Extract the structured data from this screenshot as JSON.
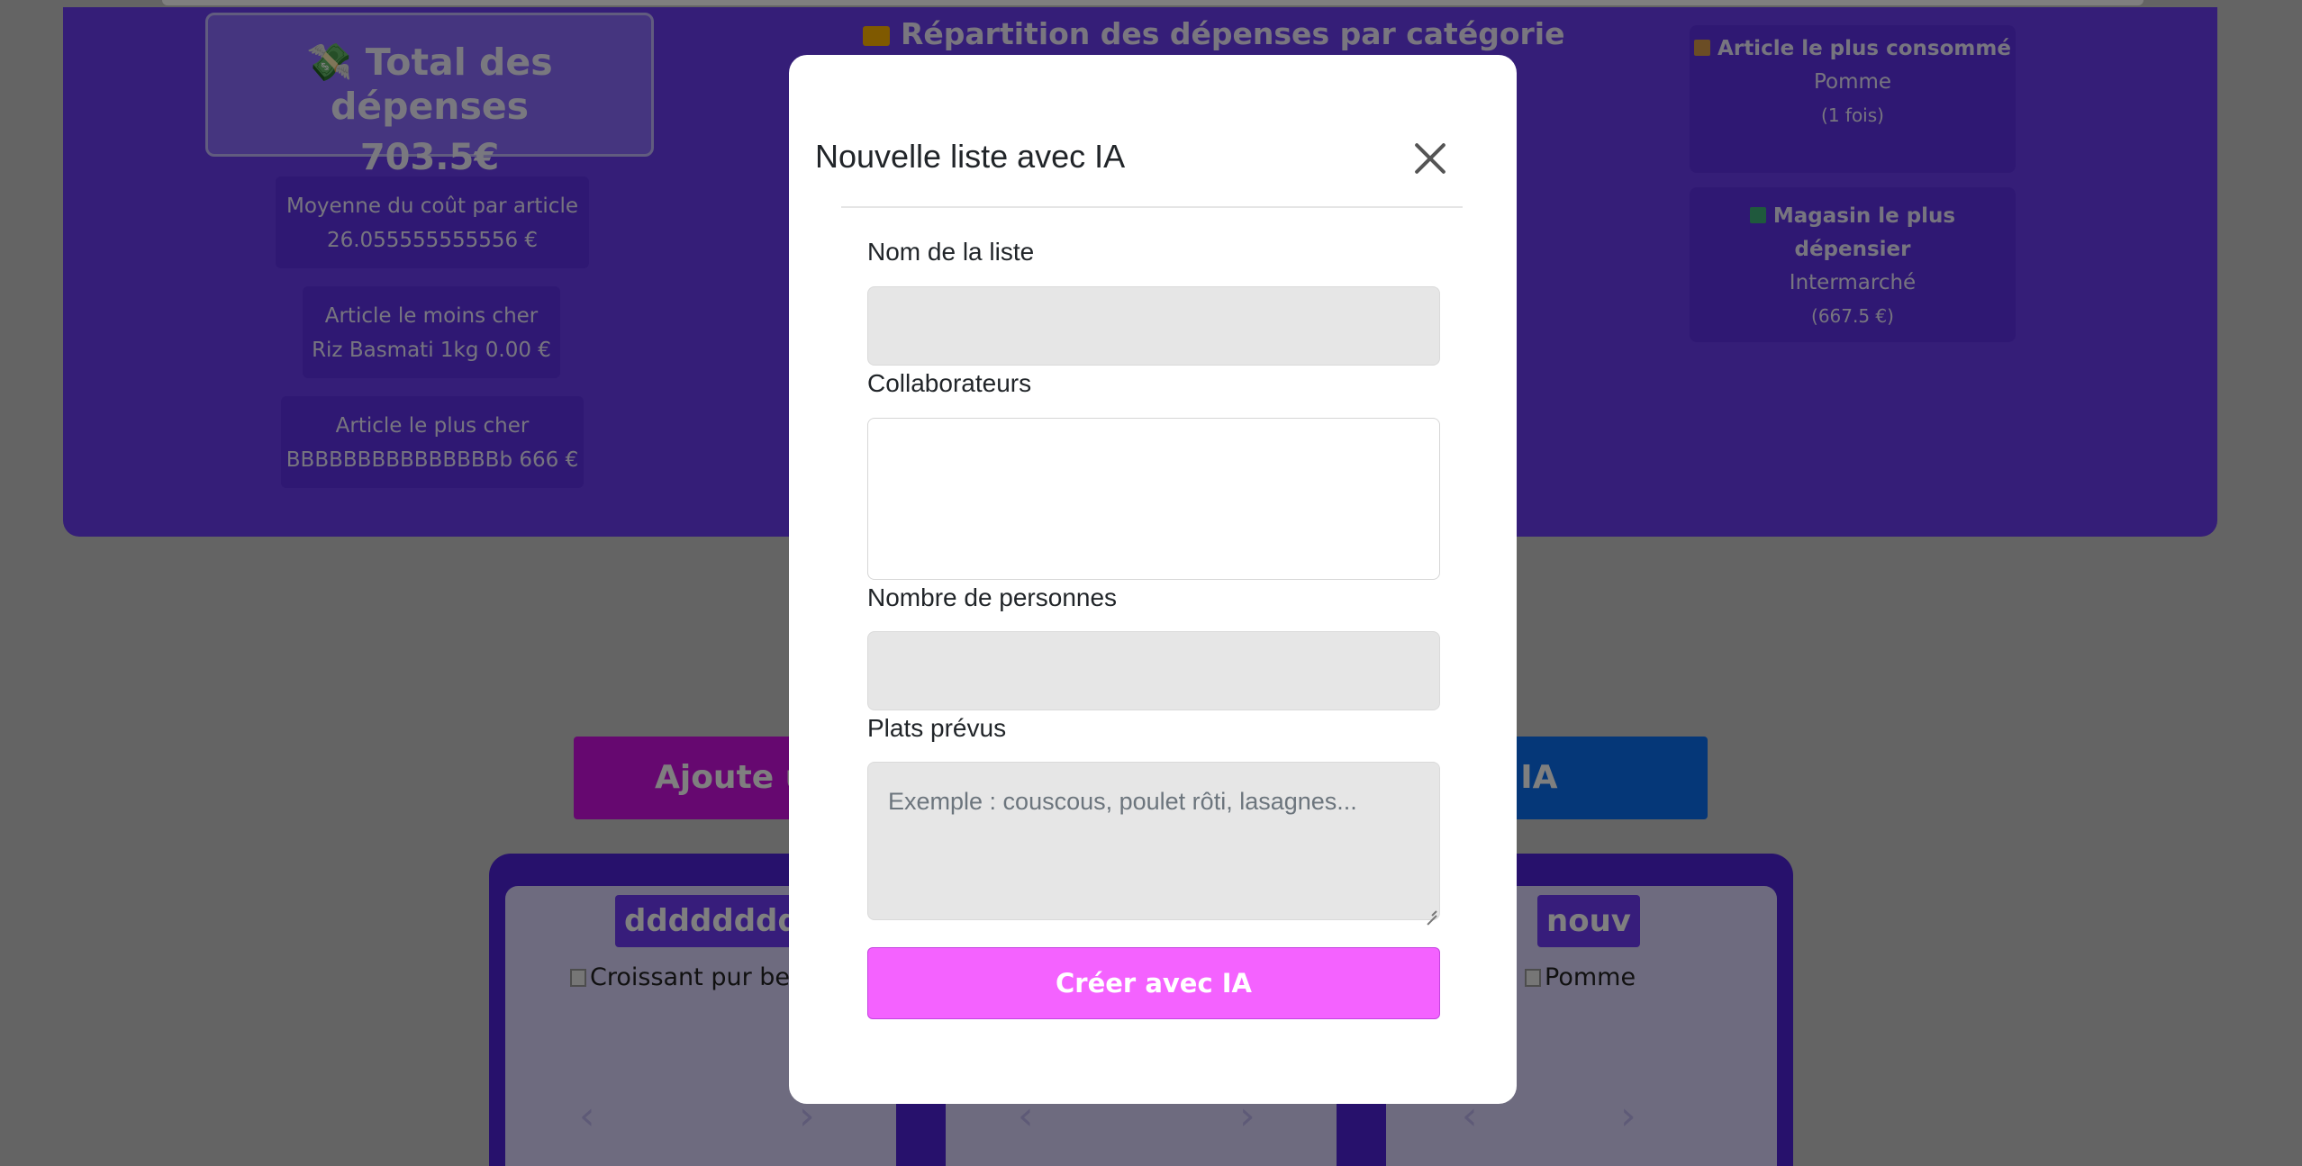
{
  "stats": {
    "total_label": "Total des dépenses",
    "total_value": "703.5€",
    "avg_label": "Moyenne du coût par article",
    "avg_value": "26.055555555556 €",
    "cheapest_label": "Article le moins cher",
    "cheapest_value": "Riz Basmati 1kg 0.00 €",
    "priciest_label": "Article le plus cher",
    "priciest_value": "BBBBBBBBBBBBBBBb 666 €",
    "category_title": "Répartition des dépenses par catégorie",
    "most_consumed_label": "Article le plus consommé",
    "most_consumed_value": "Pomme",
    "most_consumed_count": "(1 fois)",
    "top_store_label": "Magasin le plus dépensier",
    "top_store_value": "Intermarché",
    "top_store_amount": "(667.5 €)"
  },
  "actions": {
    "manual_label": "Ajoute u",
    "ai_label": "ec IA"
  },
  "cards": [
    {
      "title": "dddddddd",
      "image_alt": "Croissant pur beu"
    },
    {
      "title": "nouv",
      "image_alt": "Pomme"
    }
  ],
  "modal": {
    "title": "Nouvelle liste avec IA",
    "name_label": "Nom de la liste",
    "name_value": "",
    "collaborators_label": "Collaborateurs",
    "people_label": "Nombre de personnes",
    "people_value": "",
    "dishes_label": "Plats prévus",
    "dishes_placeholder": "Exemple : couscous, poulet rôti, lasagnes...",
    "submit_label": "Créer avec IA"
  },
  "colors": {
    "panel": "#6a3cf0",
    "manual_button": "#cc11e0",
    "ai_button": "#0a6ff0",
    "submit_button": "#f462ff"
  }
}
